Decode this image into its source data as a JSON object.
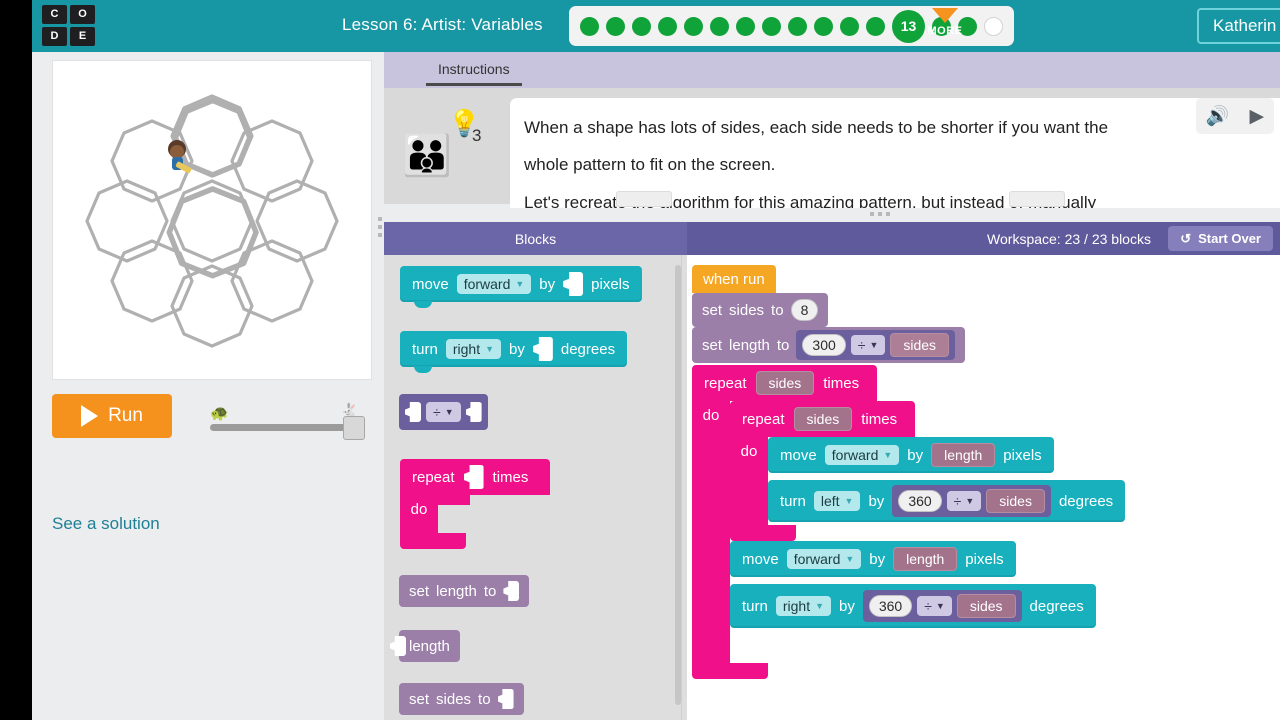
{
  "header": {
    "logo_letters": [
      "C",
      "O",
      "D",
      "E"
    ],
    "lesson_title": "Lesson 6: Artist: Variables",
    "more_label": "MORE",
    "more_icon": "triangle-down-icon",
    "user_name": "Katherin",
    "progress": {
      "completed_before": 12,
      "current_level": "13",
      "completed_after": 2,
      "remaining": 1
    }
  },
  "left_panel": {
    "run_label": "Run",
    "run_icon": "play-icon",
    "see_solution_label": "See a solution",
    "speed_slider": {
      "slow_icon": "turtle-icon",
      "fast_icon": "rabbit-icon",
      "value_percent": 89
    },
    "canvas": {
      "shape": "octagon-ring-pattern",
      "octagon_count": 9,
      "stroke_color": "#b0b0b0",
      "turtle_icon": "artist-avatar"
    }
  },
  "instructions": {
    "tab_label": "Instructions",
    "avatar_icon": "artist-character-icon",
    "bulb_icon": "lightbulb-icon",
    "bulb_count": "3",
    "paragraphs": [
      "When a shape has lots of sides, each side needs to be shorter if you want the",
      "whole pattern to fit on the screen.",
      "Let's recreate the algorithm for this amazing pattern, but instead of manually"
    ],
    "audio_icon": "speaker-icon",
    "play_icon": "play-triangle-icon"
  },
  "blockly": {
    "blocks_tab": "Blocks",
    "workspace_tab": "Workspace: 23 / 23 blocks",
    "start_over_label": "Start Over",
    "start_over_icon": "undo-icon",
    "palette": [
      {
        "id": "move-forward",
        "kind": "teal",
        "parts": [
          "move",
          "forward",
          "by",
          "slot",
          "pixels"
        ]
      },
      {
        "id": "turn-right",
        "kind": "teal",
        "parts": [
          "turn",
          "right",
          "by",
          "slot",
          "degrees"
        ]
      },
      {
        "id": "divide",
        "kind": "deeppurple",
        "parts": [
          "slot",
          "÷",
          "slot"
        ]
      },
      {
        "id": "repeat-times",
        "kind": "pink",
        "head": [
          "repeat",
          "slot",
          "times"
        ],
        "do": "do"
      },
      {
        "id": "set-length-to",
        "kind": "purple",
        "parts": [
          "set",
          "length",
          "to",
          "slot"
        ]
      },
      {
        "id": "length-var",
        "kind": "purple",
        "parts": [
          "length"
        ]
      },
      {
        "id": "set-sides-to",
        "kind": "purple",
        "parts": [
          "set",
          "sides",
          "to",
          "slot"
        ]
      }
    ],
    "palette_text": {
      "move": "move",
      "forward": "forward",
      "by": "by",
      "pixels": "pixels",
      "turn": "turn",
      "right": "right",
      "degrees": "degrees",
      "divide": "÷",
      "repeat": "repeat",
      "times": "times",
      "do": "do",
      "set": "set",
      "to": "to",
      "length": "length",
      "sides": "sides"
    },
    "workspace": {
      "when_run": "when run",
      "set_sides": {
        "set": "set",
        "var": "sides",
        "to": "to",
        "value": "8"
      },
      "set_length": {
        "set": "set",
        "var": "length",
        "to": "to",
        "numerator": "300",
        "op": "÷",
        "denominator": "sides"
      },
      "outer_repeat": {
        "repeat": "repeat",
        "count": "sides",
        "times": "times",
        "do": "do"
      },
      "inner_repeat": {
        "repeat": "repeat",
        "count": "sides",
        "times": "times",
        "do": "do"
      },
      "move_1": {
        "move": "move",
        "dir": "forward",
        "by": "by",
        "value": "length",
        "unit": "pixels"
      },
      "turn_1": {
        "turn": "turn",
        "dir": "left",
        "by": "by",
        "numerator": "360",
        "op": "÷",
        "denominator": "sides",
        "unit": "degrees"
      },
      "move_2": {
        "move": "move",
        "dir": "forward",
        "by": "by",
        "value": "length",
        "unit": "pixels"
      },
      "turn_2": {
        "turn": "turn",
        "dir": "right",
        "by": "by",
        "numerator": "360",
        "op": "÷",
        "denominator": "sides",
        "unit": "degrees"
      }
    }
  },
  "colors": {
    "header_teal": "#1796a3",
    "block_teal": "#18b0bd",
    "block_pink": "#f0108a",
    "block_purple": "#9b7fa8",
    "block_deeppurple": "#6b5f9e",
    "toolbar_purple": "#5f5a9c",
    "run_orange": "#f5921e",
    "progress_green": "#0fa33a",
    "link_blue": "#1f7f94"
  }
}
